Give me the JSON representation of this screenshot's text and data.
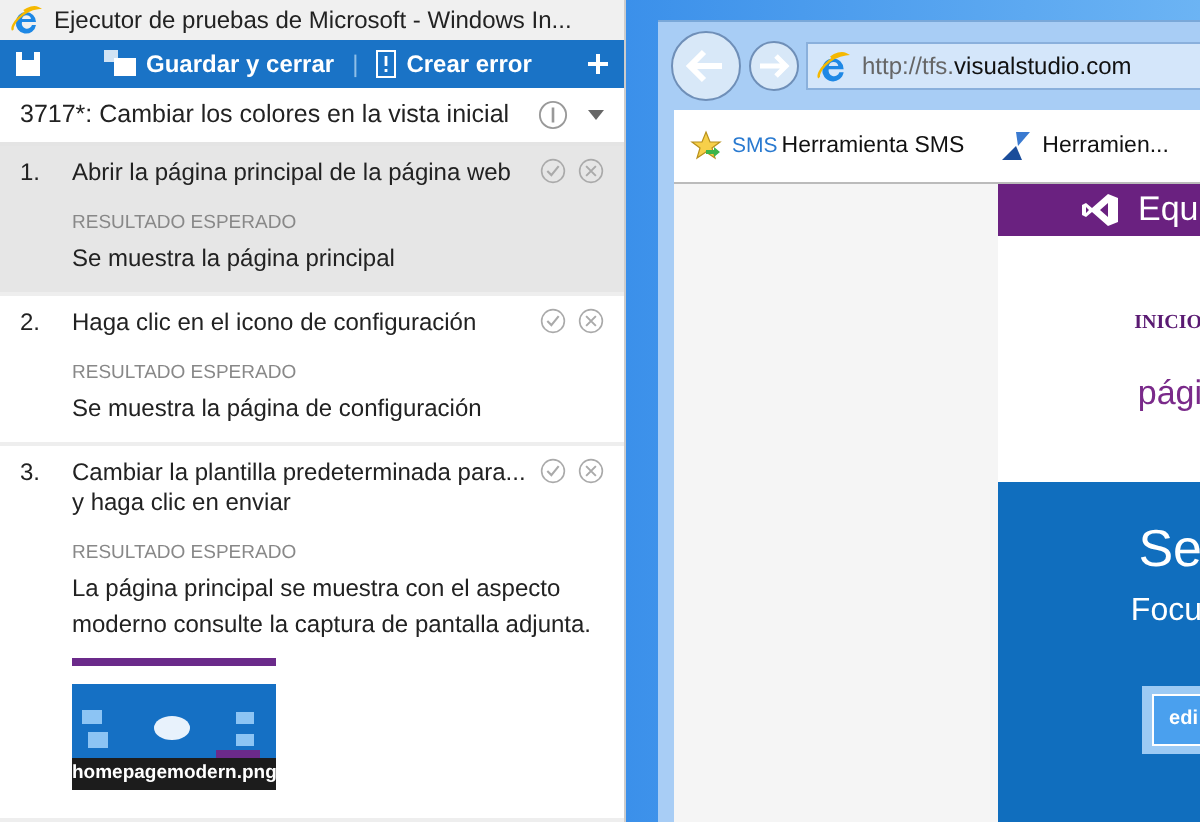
{
  "runner": {
    "window_title": "Ejecutor de pruebas de Microsoft - Windows In...",
    "toolbar": {
      "save_close": "Guardar y cerrar",
      "separator": "|",
      "create_bug": "Crear error"
    },
    "test_case": {
      "title": "3717*: Cambiar los colores en la vista inicial"
    },
    "steps": [
      {
        "number": "1.",
        "action": "Abrir la página principal de la página web",
        "expected_label": "RESULTADO ESPERADO",
        "expected": "Se muestra la página principal",
        "selected": true
      },
      {
        "number": "2.",
        "action": "Haga clic en el icono de configuración",
        "expected_label": "RESULTADO ESPERADO",
        "expected": "Se muestra la página de configuración",
        "selected": false
      },
      {
        "number": "3.",
        "action": "Cambiar la plantilla predeterminada para...\ny haga clic en enviar",
        "expected_label": "RESULTADO ESPERADO",
        "expected": "La página principal se muestra con el aspecto moderno consulte la captura de pantalla adjunta.",
        "selected": false,
        "attachment": {
          "kind": "picture",
          "caption": "homepagemodern.png"
        }
      }
    ]
  },
  "browser": {
    "address": {
      "dim": "http://tfs.",
      "bold": "visualstudio.com"
    },
    "favorites": [
      {
        "badge": "SMS",
        "label": "Herramienta SMS"
      },
      {
        "label": "Herramien..."
      }
    ],
    "site": {
      "header": "Equ",
      "nav": "INICIO",
      "subtitle": "pági",
      "hero_title": "Se",
      "hero_subtitle": "Focu",
      "hero_button": "edi"
    }
  }
}
